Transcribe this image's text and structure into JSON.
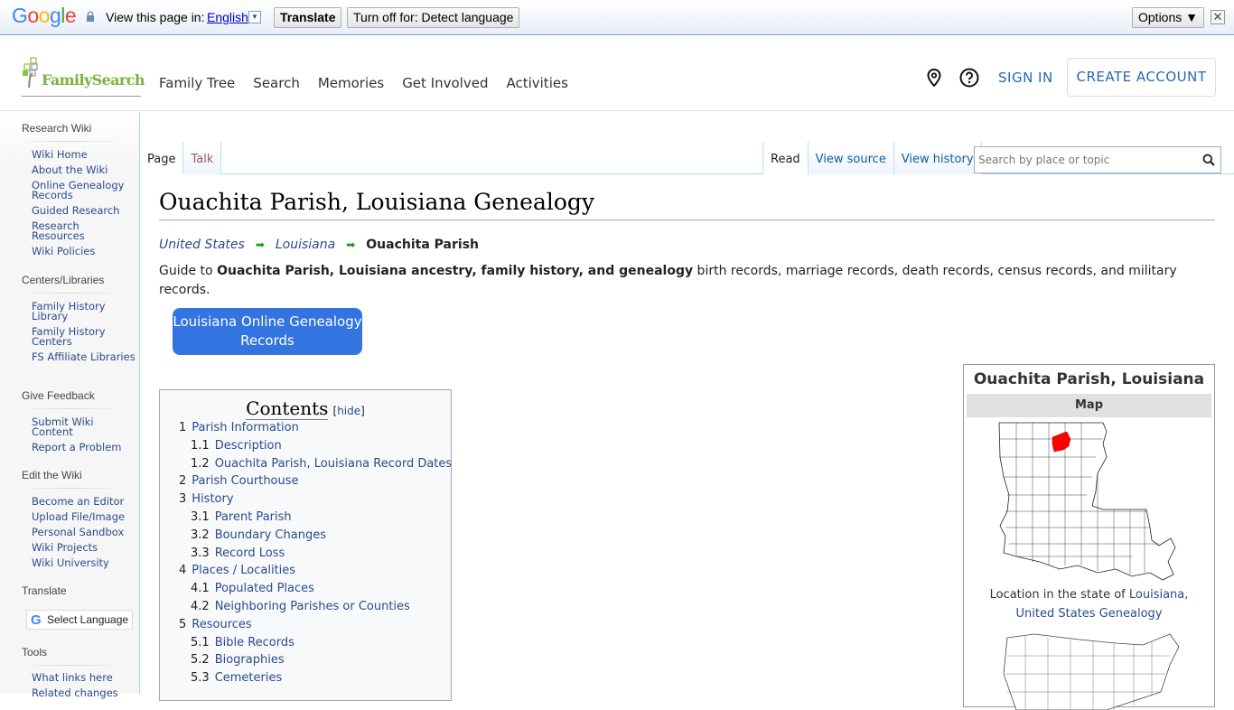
{
  "translate_bar": {
    "brand": "Google",
    "view_label": "View this page in:",
    "language": "English",
    "translate_button": "Translate",
    "turn_off_button": "Turn off for: Detect language",
    "options_button": "Options ▼",
    "close_glyph": "✕"
  },
  "header": {
    "logo_text": "FamilySearch",
    "nav": [
      "Family Tree",
      "Search",
      "Memories",
      "Get Involved",
      "Activities"
    ],
    "sign_in": "SIGN IN",
    "create_account": "CREATE ACCOUNT"
  },
  "sidebar": {
    "sections": [
      {
        "heading": "Research Wiki",
        "items": [
          "Wiki Home",
          "About the Wiki",
          "Online Genealogy Records",
          "Guided Research",
          "Research Resources",
          "Wiki Policies"
        ]
      },
      {
        "heading": "Centers/Libraries",
        "items": [
          "Family History Library",
          "Family History Centers",
          "FS Affiliate Libraries"
        ]
      },
      {
        "heading": "Give Feedback",
        "items": [
          "Submit Wiki Content",
          "Report a Problem"
        ]
      },
      {
        "heading": "Edit the Wiki",
        "items": [
          "Become an Editor",
          "Upload File/Image",
          "Personal Sandbox",
          "Wiki Projects",
          "Wiki University"
        ]
      },
      {
        "heading": "Translate",
        "items": []
      },
      {
        "heading": "Tools",
        "items": [
          "What links here",
          "Related changes"
        ]
      }
    ],
    "select_language": "Select Language"
  },
  "tabs": {
    "left": [
      "Page",
      "Talk"
    ],
    "right": [
      "Read",
      "View source",
      "View history"
    ],
    "search_placeholder": "Search by place or topic"
  },
  "article": {
    "title": "Ouachita Parish, Louisiana Genealogy",
    "breadcrumbs": [
      "United States",
      "Louisiana",
      "Ouachita Parish"
    ],
    "intro_prefix": "Guide to ",
    "intro_bold": "Ouachita Parish, Louisiana ancestry, family history, and genealogy",
    "intro_rest": " birth records, marriage records, death records, census records, and military records.",
    "records_button": "Louisiana Online Genealogy Records"
  },
  "toc": {
    "title": "Contents",
    "hide_label": "hide",
    "items": [
      {
        "num": "1",
        "label": "Parish Information",
        "level": 1
      },
      {
        "num": "1.1",
        "label": "Description",
        "level": 2
      },
      {
        "num": "1.2",
        "label": "Ouachita Parish, Louisiana Record Dates",
        "level": 2
      },
      {
        "num": "2",
        "label": "Parish Courthouse",
        "level": 1
      },
      {
        "num": "3",
        "label": "History",
        "level": 1
      },
      {
        "num": "3.1",
        "label": "Parent Parish",
        "level": 2
      },
      {
        "num": "3.2",
        "label": "Boundary Changes",
        "level": 2
      },
      {
        "num": "3.3",
        "label": "Record Loss",
        "level": 2
      },
      {
        "num": "4",
        "label": "Places / Localities",
        "level": 1
      },
      {
        "num": "4.1",
        "label": "Populated Places",
        "level": 2
      },
      {
        "num": "4.2",
        "label": "Neighboring Parishes or Counties",
        "level": 2
      },
      {
        "num": "5",
        "label": "Resources",
        "level": 1
      },
      {
        "num": "5.1",
        "label": "Bible Records",
        "level": 2
      },
      {
        "num": "5.2",
        "label": "Biographies",
        "level": 2
      },
      {
        "num": "5.3",
        "label": "Cemeteries",
        "level": 2
      }
    ]
  },
  "infobox": {
    "title": "Ouachita Parish, Louisiana",
    "subheader": "Map",
    "caption_prefix": "Location in the state of ",
    "caption_link1": "Louisiana,",
    "caption_link2": "United States Genealogy",
    "highlight_color": "#ff0000"
  }
}
